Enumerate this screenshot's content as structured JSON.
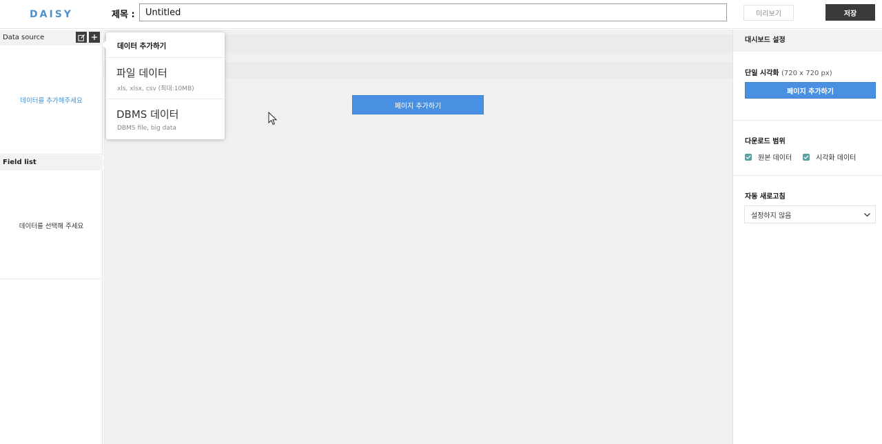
{
  "header": {
    "logo": "DAISY",
    "title_label": "제목 :",
    "title_value": "Untitled",
    "preview_label": "미리보기",
    "save_label": "저장"
  },
  "left": {
    "data_source_label": "Data source",
    "data_source_empty": "데이터를 추가해주세요",
    "field_list_label": "Field list",
    "field_list_empty": "데이터를 선택해 주세요"
  },
  "menu": {
    "title": "데이터 추가하기",
    "items": [
      {
        "title": "파일 데이터",
        "subtitle": "xls, xlsx, csv (최대:10MB)"
      },
      {
        "title": "DBMS 데이터",
        "subtitle": "DBMS file, big data"
      }
    ]
  },
  "center": {
    "add_page_label": "페이지 추가하기"
  },
  "right": {
    "header": "대시보드 설정",
    "single_vis_label": "단일 시각화",
    "single_vis_note": "(720 x 720 px)",
    "add_page_label": "페이지 추가하기",
    "download_label": "다운로드 범위",
    "download_options": [
      {
        "label": "원본 데이터",
        "checked": true
      },
      {
        "label": "시각화 데이터",
        "checked": true
      }
    ],
    "refresh_label": "자동 새로고침",
    "refresh_value": "설정하지 않음"
  },
  "colors": {
    "accent": "#4a90e2",
    "logo": "#4f8fca",
    "checkbox": "#58a2a2",
    "dark_button": "#3a3a3a"
  }
}
